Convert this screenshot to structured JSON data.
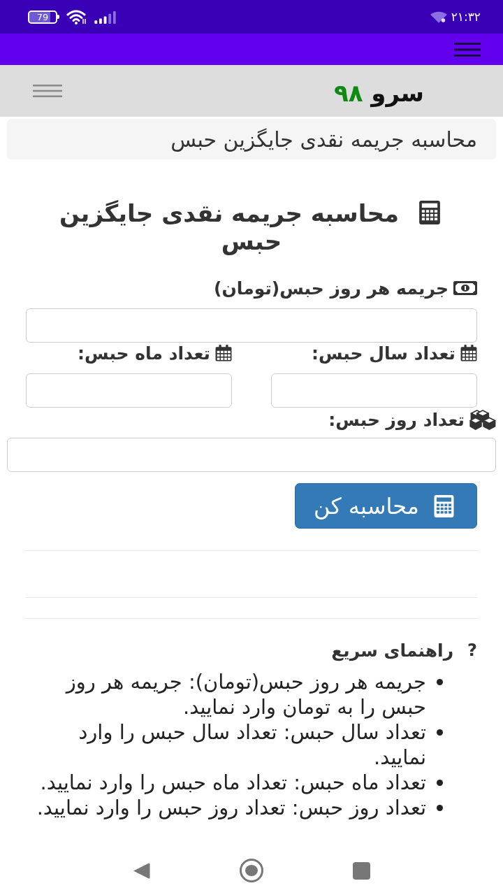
{
  "status_bar": {
    "battery": "79",
    "time": "۲۱:۳۲"
  },
  "site_header": {
    "logo_name": "سرو",
    "logo_number": "۹۸"
  },
  "breadcrumb": "محاسبه جریمه نقدی جایگزین حبس",
  "heading": "محاسبه جریمه نقدی جایگزین حبس",
  "form": {
    "fine_per_day_label": "جریمه هر روز حبس(تومان)",
    "years_label": "تعداد سال حبس:",
    "months_label": "تعداد ماه حبس:",
    "days_label": "تعداد روز حبس:",
    "submit_button": "محاسبه کن"
  },
  "help": {
    "icon": "?",
    "title": "راهنمای سریع",
    "items": [
      "جریمه هر روز حبس(تومان): جریمه هر روز حبس را به تومان وارد نمایید.",
      "تعداد سال حبس: تعداد سال حبس را وارد نمایید.",
      "تعداد ماه حبس: تعداد ماه حبس را وارد نمایید.",
      "تعداد روز حبس: تعداد روز حبس را وارد نمایید."
    ]
  }
}
